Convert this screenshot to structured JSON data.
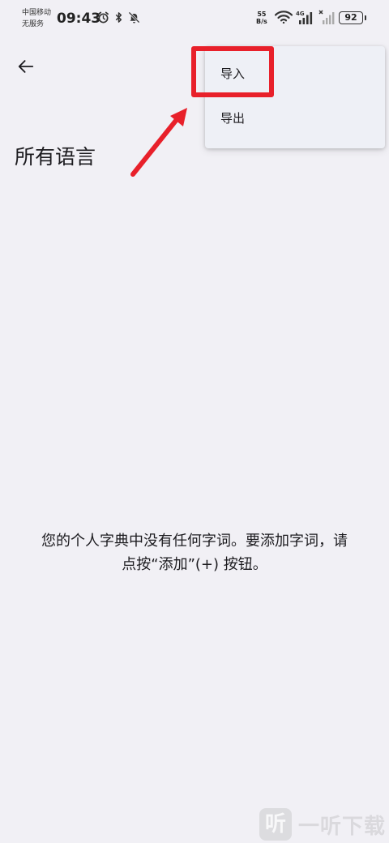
{
  "status_bar": {
    "carrier_line1": "中国移动",
    "carrier_line2": "无服务",
    "time": "09:43",
    "net_speed_value": "55",
    "net_speed_unit": "B/s",
    "network_type": "4G",
    "battery_level": "92",
    "icons": [
      "alarm-icon",
      "bluetooth-icon",
      "mute-icon",
      "wifi-icon",
      "signal-icon",
      "no-sim-signal-icon",
      "battery-icon"
    ]
  },
  "header": {
    "back_icon": "arrow-left-icon",
    "title": "所有语言"
  },
  "menu": {
    "items": [
      {
        "label": "导入"
      },
      {
        "label": "导出"
      }
    ]
  },
  "empty_state": {
    "line1": "您的个人字典中没有任何字词。要添加字词，请",
    "line2": "点按“添加”(+) 按钮。"
  },
  "annotation": {
    "highlight_color": "#e8202a"
  },
  "watermark": {
    "logo": "听",
    "text": "一听下载"
  },
  "colors": {
    "background": "#f1f0f5",
    "menu_background": "#eef0f6",
    "text": "#1c1b1f"
  }
}
